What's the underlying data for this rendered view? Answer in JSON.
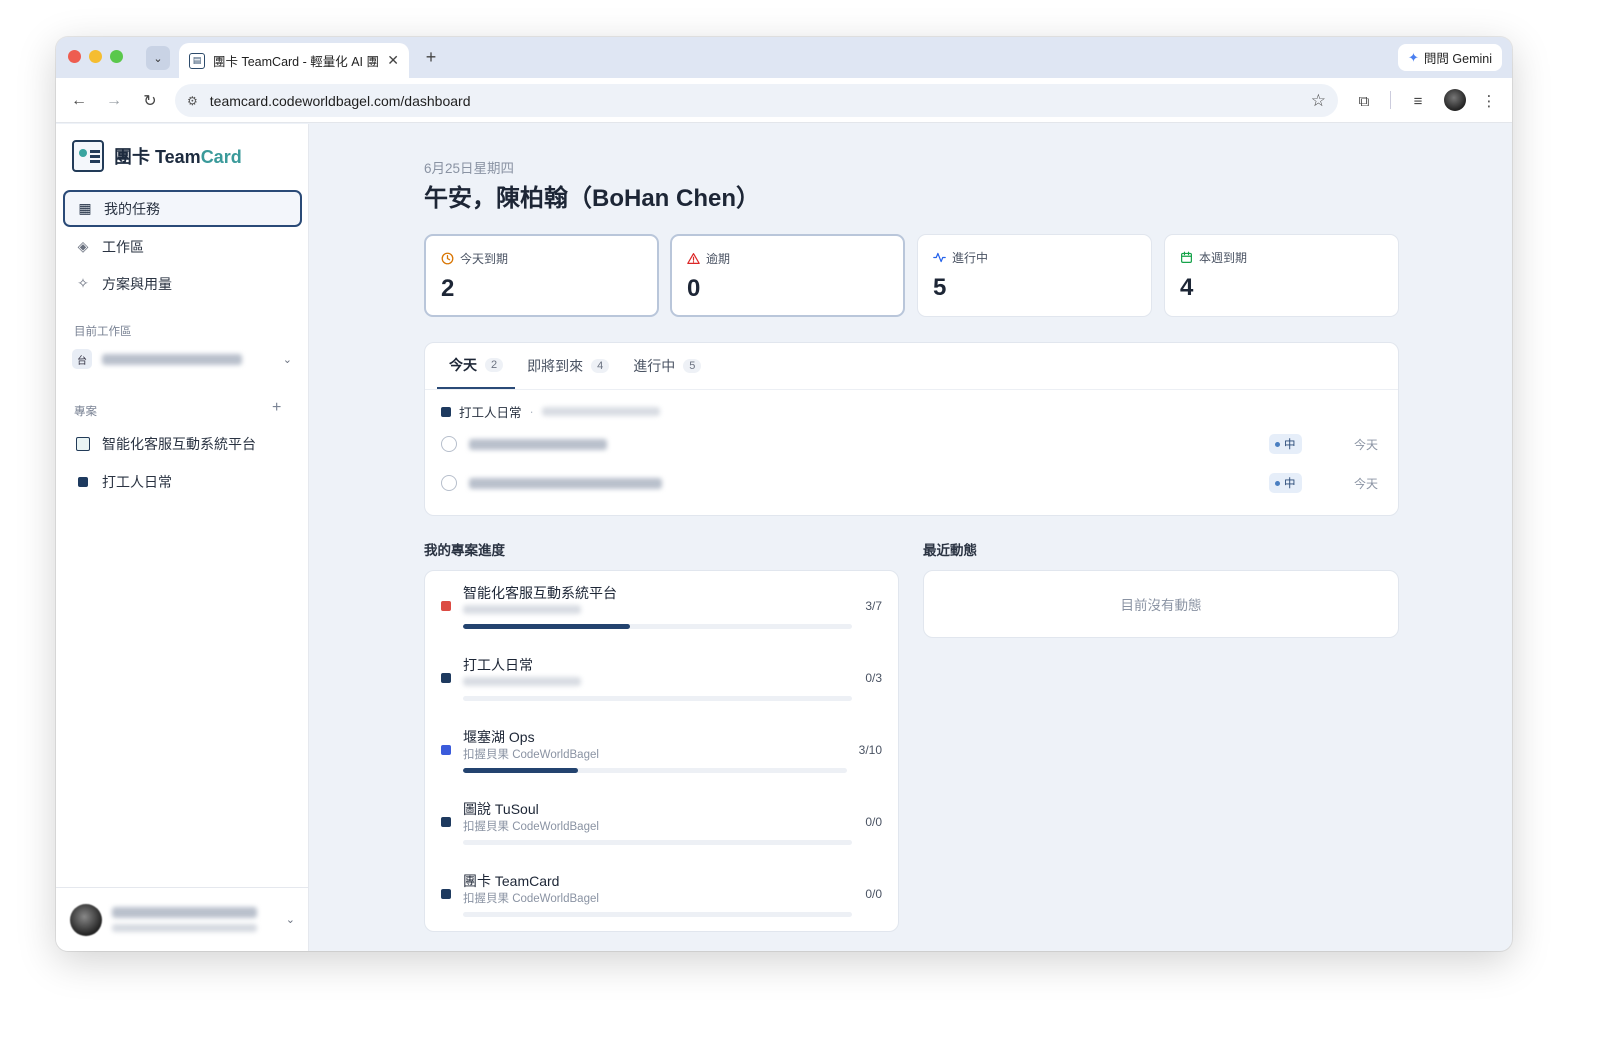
{
  "browser": {
    "tab_title": "團卡 TeamCard - 輕量化 AI 團隊",
    "gemini_label": "問問 Gemini",
    "url": "teamcard.codeworldbagel.com/dashboard"
  },
  "sidebar": {
    "brand_prefix": "團卡 Team",
    "brand_highlight": "Card",
    "nav": [
      {
        "label": "我的任務",
        "icon": "dashboard-grid-icon",
        "active": true
      },
      {
        "label": "工作區",
        "icon": "layers-icon",
        "active": false
      },
      {
        "label": "方案與用量",
        "icon": "sparkle-icon",
        "active": false
      }
    ],
    "workspace_label": "目前工作區",
    "workspace_badge": "台",
    "projects_label": "專案",
    "projects": [
      {
        "name": "智能化客服互動系統平台",
        "icon": "teamcard-logo-icon"
      },
      {
        "name": "打工人日常",
        "color": "#1e3a5f"
      }
    ]
  },
  "main": {
    "date": "6月25日星期四",
    "greeting": "午安，陳柏翰（BoHan Chen）",
    "stats": [
      {
        "label": "今天到期",
        "value": "2",
        "icon": "clock-icon",
        "color": "#d97706"
      },
      {
        "label": "逾期",
        "value": "0",
        "icon": "alert-triangle-icon",
        "color": "#dc2626"
      },
      {
        "label": "進行中",
        "value": "5",
        "icon": "activity-icon",
        "color": "#2563eb"
      },
      {
        "label": "本週到期",
        "value": "4",
        "icon": "calendar-icon",
        "color": "#16a34a"
      }
    ],
    "task_tabs": [
      {
        "label": "今天",
        "count": "2"
      },
      {
        "label": "即將到來",
        "count": "4"
      },
      {
        "label": "進行中",
        "count": "5"
      }
    ],
    "task_group": "打工人日常",
    "tasks": [
      {
        "priority": "中",
        "due": "今天"
      },
      {
        "priority": "中",
        "due": "今天"
      }
    ],
    "projects_title": "我的專案進度",
    "activity_title": "最近動態",
    "activity_empty": "目前沒有動態",
    "projects": [
      {
        "name": "智能化客服互動系統平台",
        "company": "",
        "count": "3/7",
        "progress": 0.43,
        "color": "#dc4b43"
      },
      {
        "name": "打工人日常",
        "company": "",
        "count": "0/3",
        "progress": 0,
        "color": "#1e3a5f"
      },
      {
        "name": "堰塞湖 Ops",
        "company": "扣握貝果 CodeWorldBagel",
        "count": "3/10",
        "progress": 0.3,
        "color": "#3b5bdb"
      },
      {
        "name": "圖說 TuSoul",
        "company": "扣握貝果 CodeWorldBagel",
        "count": "0/0",
        "progress": 0,
        "color": "#1e3a5f"
      },
      {
        "name": "團卡 TeamCard",
        "company": "扣握貝果 CodeWorldBagel",
        "count": "0/0",
        "progress": 0,
        "color": "#1e3a5f"
      }
    ]
  }
}
